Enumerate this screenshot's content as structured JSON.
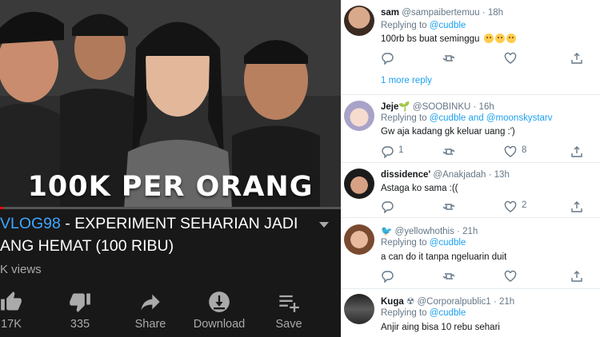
{
  "video": {
    "overlay_text": "100K PER ORANG",
    "progress_fraction": 0.01,
    "title_tag": "VLOG98",
    "title_rest": " - EXPERIMENT SEHARIAN JADI ANG HEMAT (100 RIBU)",
    "views": "K views",
    "actions": {
      "like_count": "17K",
      "dislike_count": "335",
      "share_label": "Share",
      "download_label": "Download",
      "save_label": "Save"
    },
    "colors": {
      "background": "#181818",
      "link": "#3ea6ff",
      "text": "#ffffff",
      "muted": "#aaaaaa"
    }
  },
  "tweets": [
    {
      "name": "sam",
      "handle": "@sampaibertemuu",
      "time": "18h",
      "replying_prefix": "Replying to ",
      "replying_mentions": "@cudble",
      "text": "100rb bs buat seminggu",
      "emoji_count": 3,
      "replies": "",
      "retweets": "",
      "likes": ""
    },
    {
      "name": "Jeje",
      "handle": "@SOOBINKU",
      "time": "16h",
      "replying_prefix": "Replying to ",
      "replying_mentions": "@cudble and @moonskystarv",
      "text": "Gw aja kadang gk keluar uang :')",
      "replies": "1",
      "retweets": "",
      "likes": "8"
    },
    {
      "name": "dissidence'",
      "handle": "@Anakjadah",
      "time": "13h",
      "replying_prefix": "",
      "replying_mentions": "",
      "text": "Astaga ko sama :((",
      "replies": "",
      "retweets": "",
      "likes": "2"
    },
    {
      "name": "",
      "handle": "@yellowhothis",
      "time": "21h",
      "replying_prefix": "Replying to ",
      "replying_mentions": "@cudble",
      "text": "a can do it tanpa ngeluarin duit",
      "replies": "",
      "retweets": "",
      "likes": ""
    },
    {
      "name": "Kuga",
      "handle": "@Corporalpublic1",
      "time": "21h",
      "replying_prefix": "Replying to ",
      "replying_mentions": "@cudble",
      "text": "Anjir aing bisa 10 rebu sehari",
      "replies": "",
      "retweets": "",
      "likes": ""
    }
  ],
  "more_replies": "1 more reply",
  "icons": [
    "thumbs-up-icon",
    "thumbs-down-icon",
    "share-icon",
    "download-icon",
    "save-playlist-icon",
    "chevron-down-icon",
    "reply-icon",
    "retweet-icon",
    "like-icon",
    "tweet-share-icon"
  ],
  "colors": {
    "twitter_blue": "#1da1f2",
    "twitter_gray": "#657786",
    "separator": "#e6ecf0"
  }
}
